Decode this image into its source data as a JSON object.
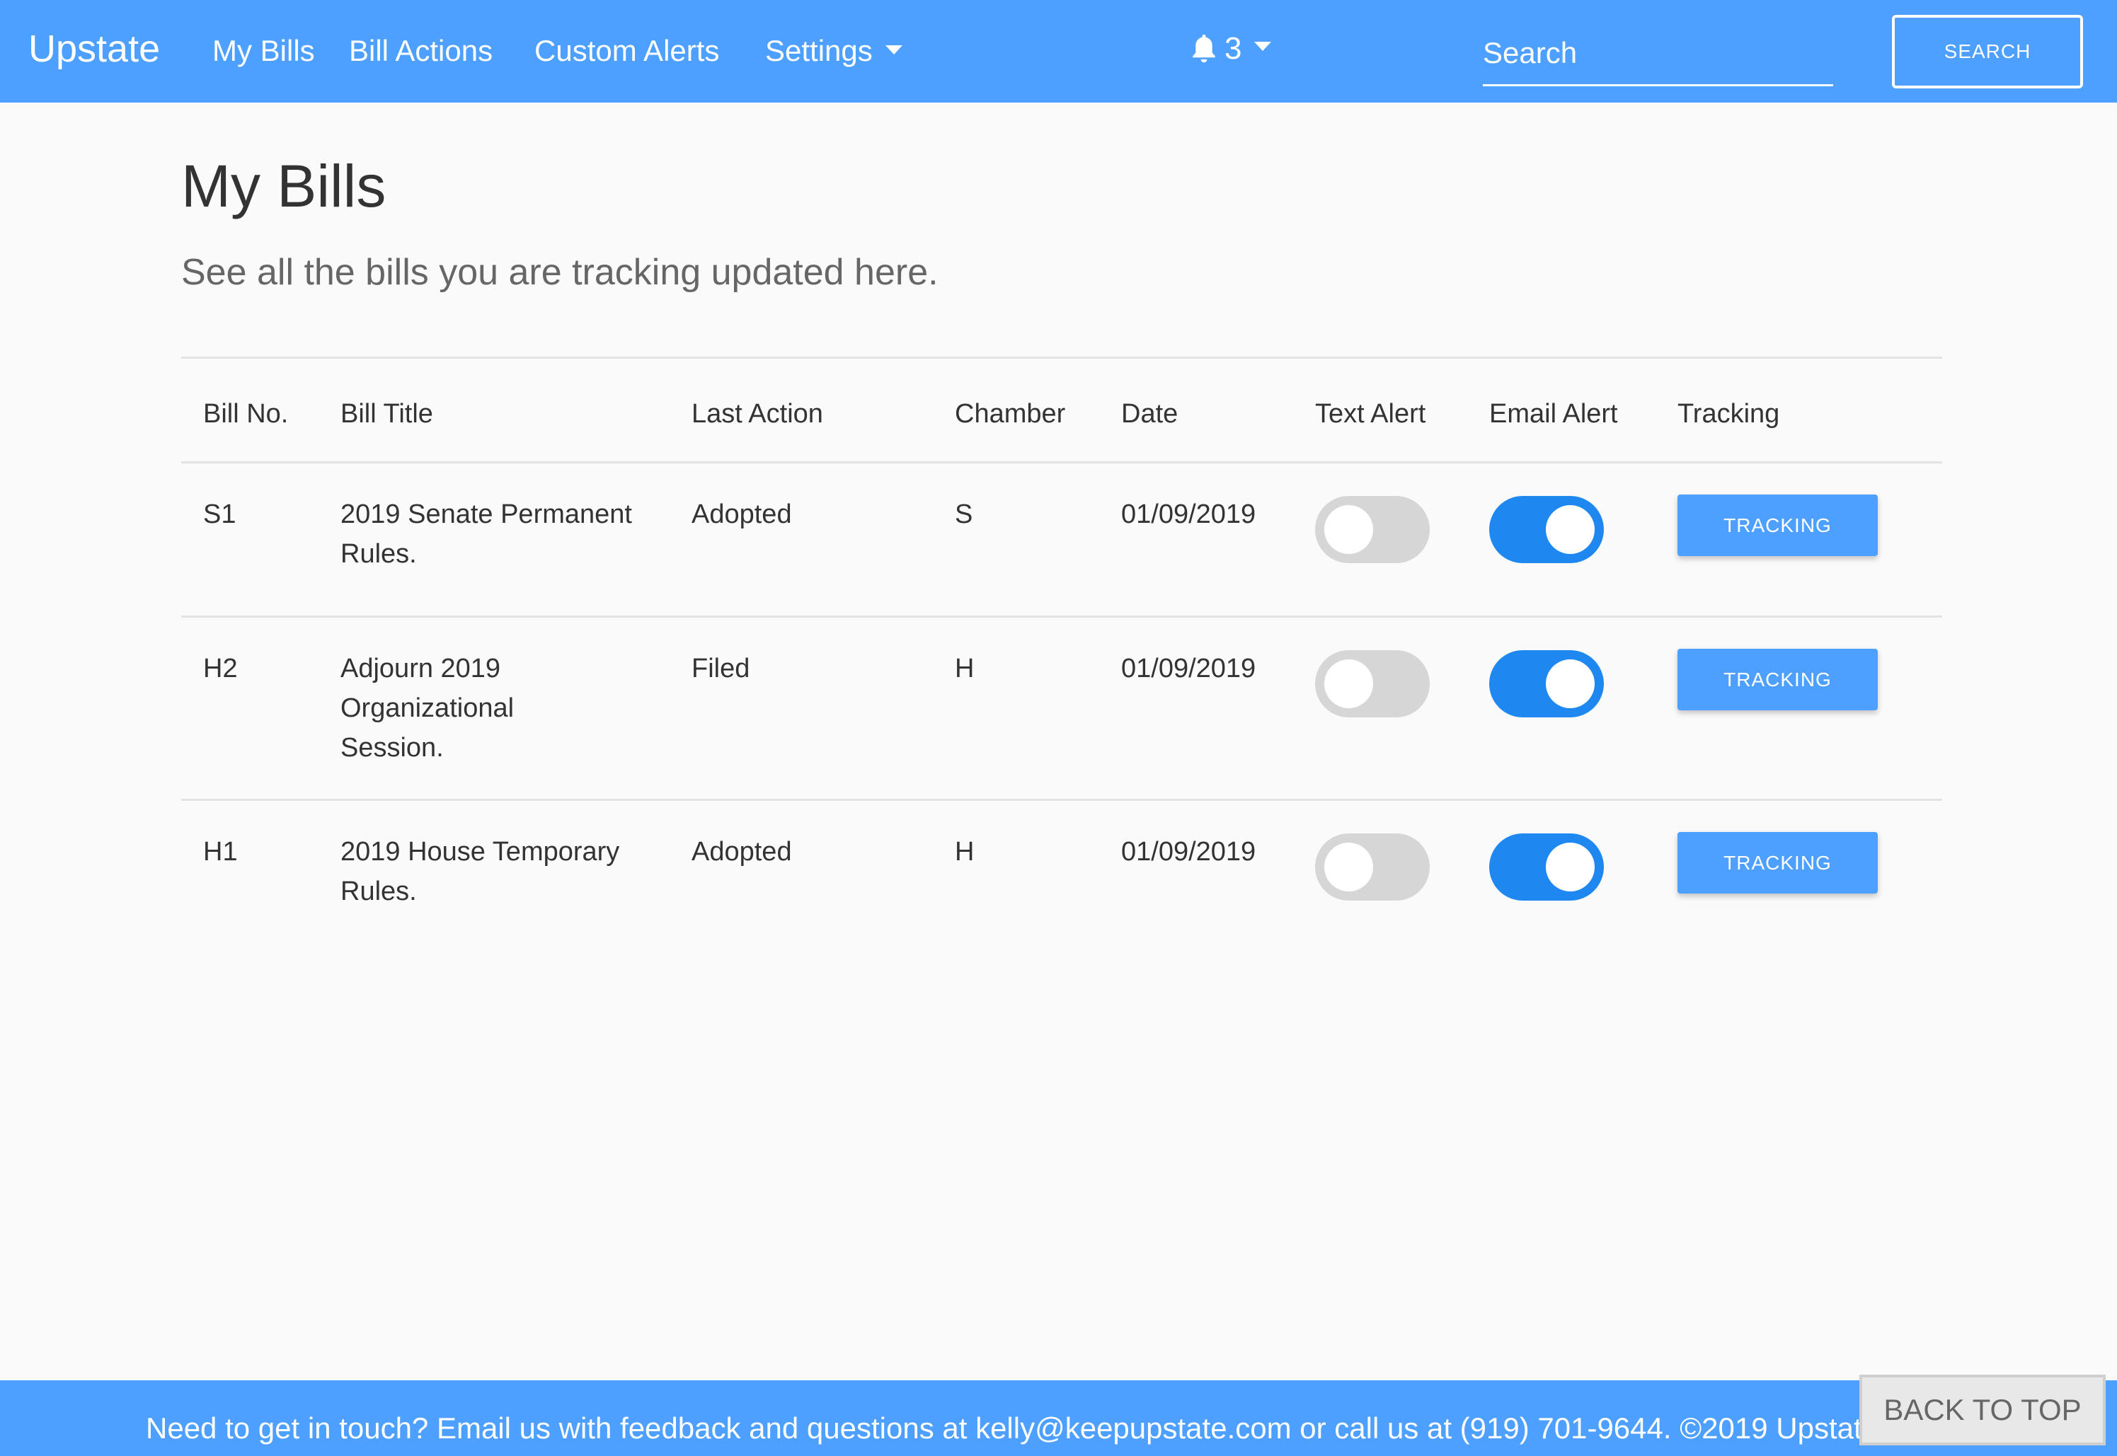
{
  "navbar": {
    "brand": "Upstate",
    "links": [
      "My Bills",
      "Bill Actions",
      "Custom Alerts",
      "Settings"
    ],
    "notification_count": "3",
    "search_placeholder": "Search",
    "search_button": "SEARCH",
    "accent_color": "#4da0ff"
  },
  "page": {
    "title": "My Bills",
    "subtitle": "See all the bills you are tracking updated here."
  },
  "table": {
    "headers": [
      "Bill No.",
      "Bill Title",
      "Last Action",
      "Chamber",
      "Date",
      "Text Alert",
      "Email Alert",
      "Tracking"
    ],
    "rows": [
      {
        "bill_no": "S1",
        "title": "2019 Senate Permanent Rules.",
        "last_action": "Adopted",
        "chamber": "S",
        "date": "01/09/2019",
        "text_alert": false,
        "email_alert": true,
        "tracking_label": "TRACKING"
      },
      {
        "bill_no": "H2",
        "title": "Adjourn 2019 Organizational Session.",
        "last_action": "Filed",
        "chamber": "H",
        "date": "01/09/2019",
        "text_alert": false,
        "email_alert": true,
        "tracking_label": "TRACKING"
      },
      {
        "bill_no": "H1",
        "title": "2019 House Temporary Rules.",
        "last_action": "Adopted",
        "chamber": "H",
        "date": "01/09/2019",
        "text_alert": false,
        "email_alert": true,
        "tracking_label": "TRACKING"
      }
    ]
  },
  "footer": {
    "text": "Need to get in touch? Email us with feedback and questions at kelly@keepupstate.com or call us at (919) 701-9644. ©2019 Upstate",
    "back_to_top": "BACK TO TOP"
  },
  "colors": {
    "toggle_on": "#1e88f0",
    "toggle_off": "#d6d6d6",
    "background": "#fafafa"
  }
}
